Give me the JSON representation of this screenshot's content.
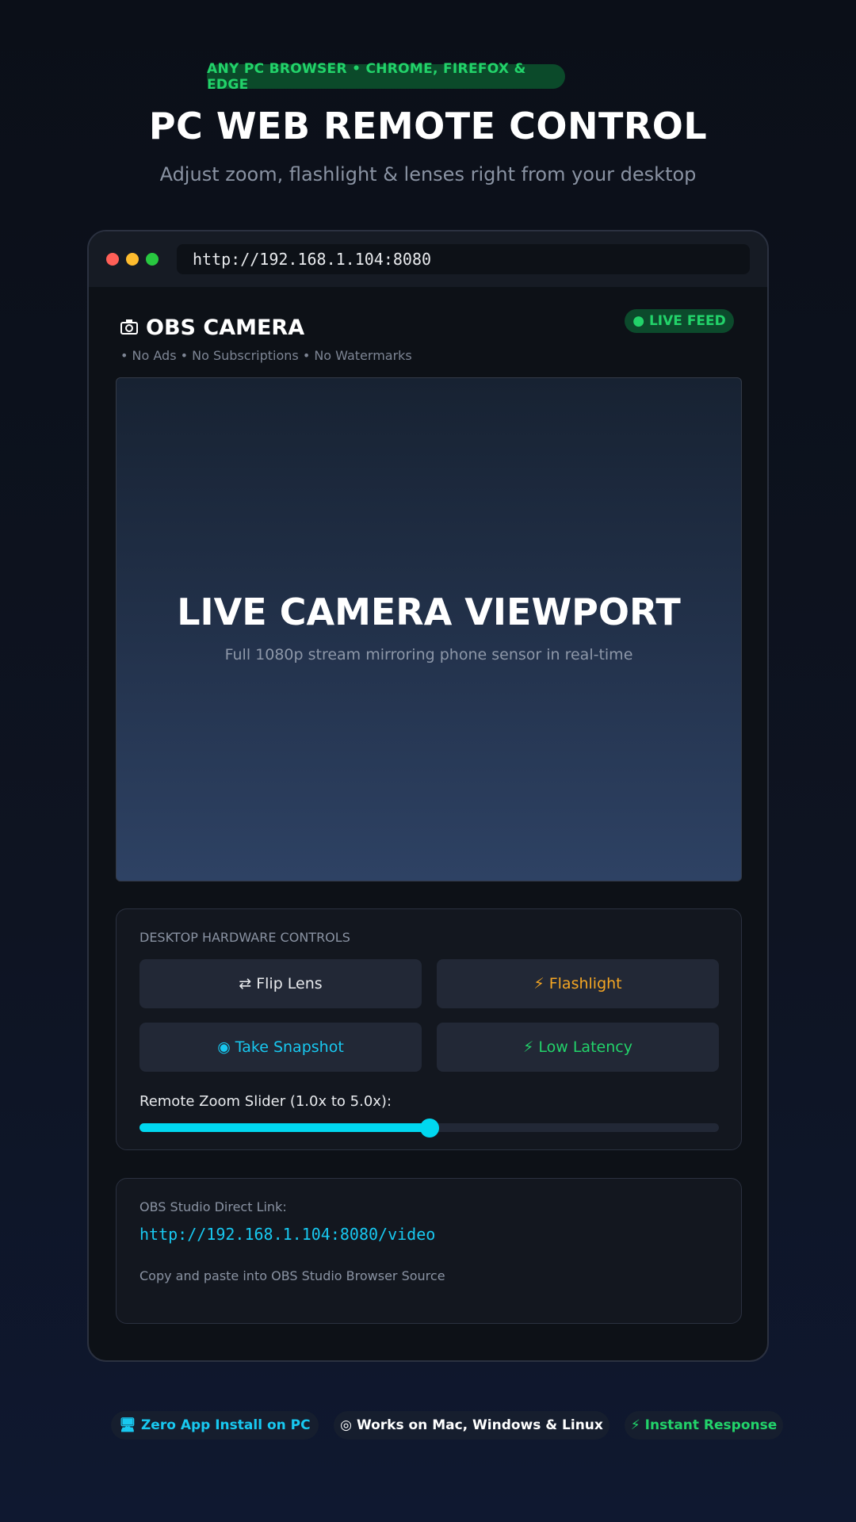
{
  "hero": {
    "badge": "ANY PC BROWSER • CHROME, FIREFOX & EDGE",
    "title": "PC WEB REMOTE CONTROL",
    "subtitle": "Adjust zoom, flashlight & lenses right from your desktop"
  },
  "browser": {
    "url": "http://192.168.1.104:8080"
  },
  "app": {
    "title_icon": "camera-icon",
    "title": "OBS CAMERA",
    "tagline": "• No Ads • No Subscriptions • No Watermarks",
    "live_badge": "● LIVE FEED"
  },
  "viewport": {
    "title": "LIVE CAMERA VIEWPORT",
    "subtitle": "Full 1080p stream mirroring phone sensor in real-time"
  },
  "controls": {
    "label": "DESKTOP HARDWARE CONTROLS",
    "buttons": [
      {
        "icon": "flip-icon",
        "icon_glyph": "⇄",
        "label": "Flip Lens",
        "color": "#e8eaed"
      },
      {
        "icon": "flashlight-icon",
        "icon_glyph": "⚡",
        "label": "Flashlight",
        "color": "#f5a623"
      },
      {
        "icon": "camera-icon",
        "icon_glyph": "◉",
        "label": "Take Snapshot",
        "color": "#18c8f0"
      },
      {
        "icon": "lightning-icon",
        "icon_glyph": "⚡",
        "label": "Low Latency",
        "color": "#22d36a"
      }
    ],
    "slider_label": "Remote Zoom Slider (1.0x to 5.0x):",
    "slider_fraction": 0.5
  },
  "obs": {
    "label": "OBS Studio Direct Link:",
    "link": "http://192.168.1.104:8080/video",
    "hint": "Copy and paste into OBS Studio Browser Source"
  },
  "features": [
    {
      "icon": "desktop-icon",
      "icon_glyph": "🖥",
      "label": "Zero App Install on PC"
    },
    {
      "icon": "globe-icon",
      "icon_glyph": "◎",
      "label": "Works on Mac, Windows & Linux"
    },
    {
      "icon": "bolt-icon",
      "icon_glyph": "⚡",
      "label": "Instant Response"
    }
  ],
  "colors": {
    "accent_green": "#22d36a",
    "accent_cyan": "#18c8f0",
    "accent_orange": "#f5a623"
  }
}
